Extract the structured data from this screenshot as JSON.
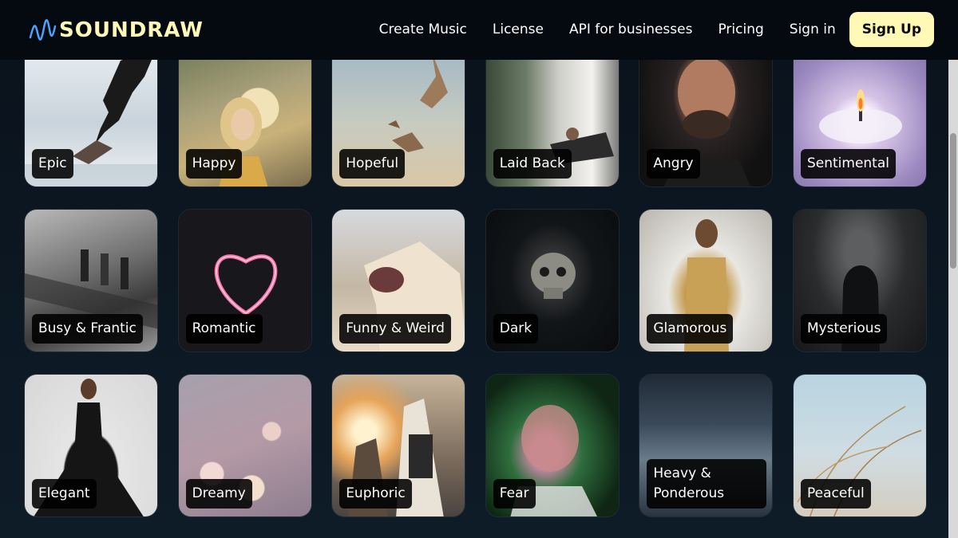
{
  "brand": {
    "name": "SOUNDRAW"
  },
  "nav": {
    "items": [
      {
        "label": "Create Music"
      },
      {
        "label": "License"
      },
      {
        "label": "API for businesses"
      },
      {
        "label": "Pricing"
      },
      {
        "label": "Sign in"
      }
    ],
    "signup_label": "Sign Up"
  },
  "colors": {
    "accent": "#fff9b5",
    "background": "#0e1c28",
    "topbar": "#050a10"
  },
  "moods": [
    {
      "label": "Epic"
    },
    {
      "label": "Happy"
    },
    {
      "label": "Hopeful"
    },
    {
      "label": "Laid Back"
    },
    {
      "label": "Angry"
    },
    {
      "label": "Sentimental"
    },
    {
      "label": "Busy & Frantic"
    },
    {
      "label": "Romantic"
    },
    {
      "label": "Funny & Weird"
    },
    {
      "label": "Dark"
    },
    {
      "label": "Glamorous"
    },
    {
      "label": "Mysterious"
    },
    {
      "label": "Elegant"
    },
    {
      "label": "Dreamy"
    },
    {
      "label": "Euphoric"
    },
    {
      "label": "Fear"
    },
    {
      "label": "Heavy & Ponderous"
    },
    {
      "label": "Peaceful"
    }
  ]
}
